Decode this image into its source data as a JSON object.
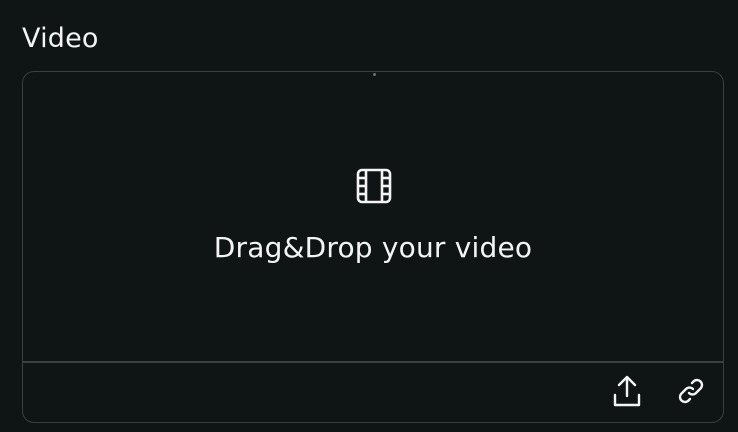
{
  "field": {
    "label": "Video"
  },
  "dropzone": {
    "icon": "film-icon",
    "text": "Drag&Drop your video"
  },
  "toolbar": {
    "upload_icon": "upload-icon",
    "link_icon": "link-icon"
  },
  "colors": {
    "background": "#0f1415",
    "border": "#3a3f41",
    "text": "#f4f4f4"
  }
}
